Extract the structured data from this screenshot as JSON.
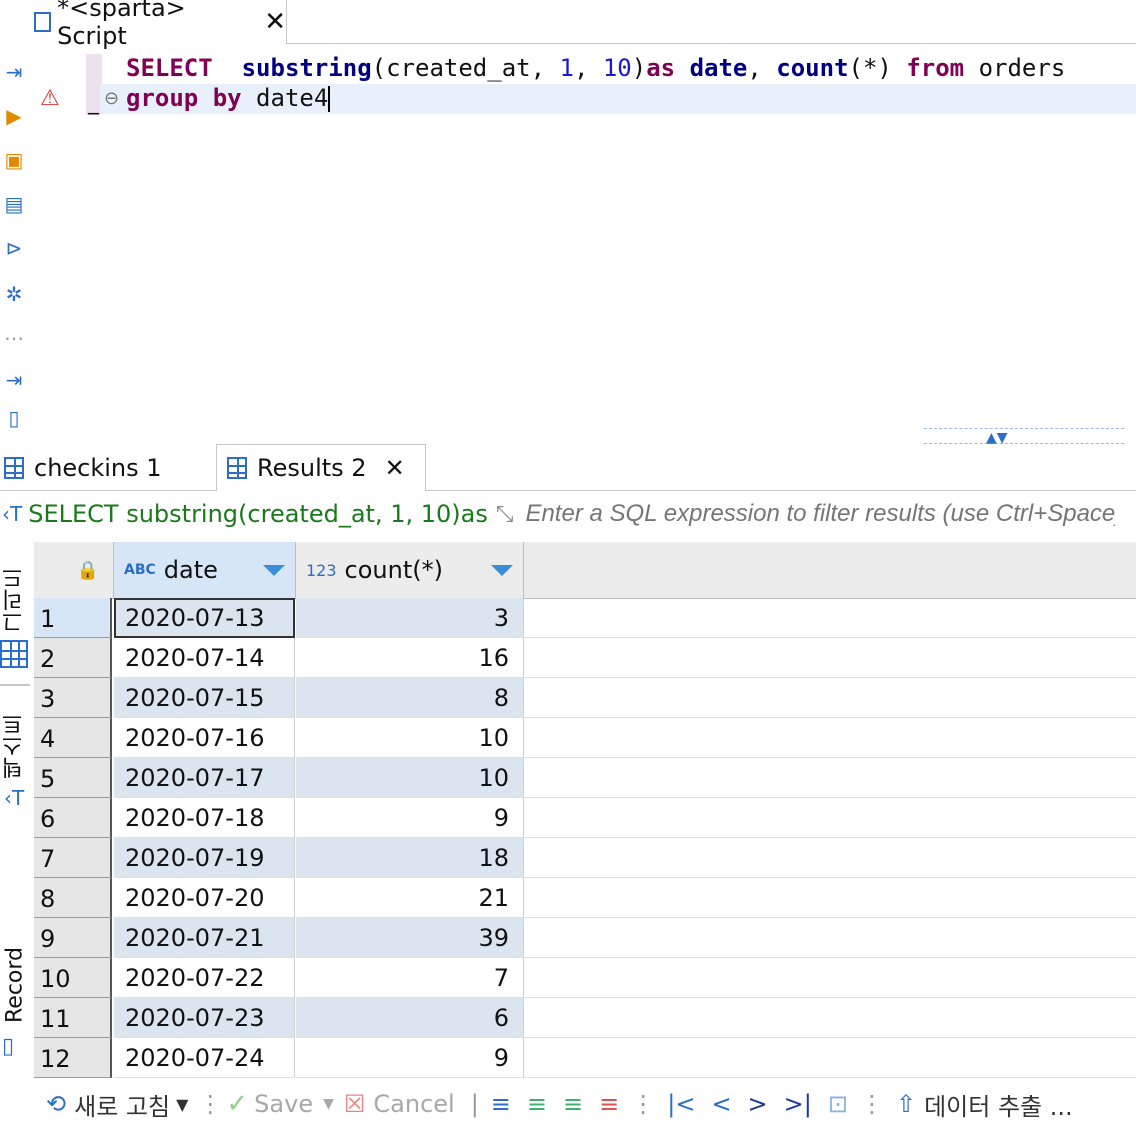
{
  "editor_tab": {
    "title": "*<sparta> Script",
    "close": "✕"
  },
  "editor": {
    "line1": {
      "kw_select": "SELECT",
      "fn_substring": "substring",
      "args": "(created_at, ",
      "n1": "1",
      "comma": ", ",
      "n2": "10",
      "paren": ")",
      "kw_as": "as",
      "date": " date",
      "comma2": ", ",
      "fn_count": "count",
      "count_args": "(*) ",
      "kw_from": "from",
      "table": " orders"
    },
    "line2": {
      "kw_group": "group",
      "kw_by": " by",
      "rest": " date4"
    }
  },
  "results_tabs": [
    {
      "label": "checkins 1"
    },
    {
      "label": "Results 2",
      "close": "✕"
    }
  ],
  "filter_bar": {
    "query_echo": "SELECT substring(created_at, 1, 10)as",
    "placeholder": "Enter a SQL expression to filter results (use Ctrl+Space)"
  },
  "side_tabs": {
    "grid": "그리드",
    "text": "텍스트",
    "record": "Record"
  },
  "grid": {
    "columns": [
      {
        "type_badge": "ABC",
        "name": "date"
      },
      {
        "type_badge": "123",
        "name": "count(*)"
      }
    ],
    "rows": [
      {
        "n": "1",
        "date": "2020-07-13",
        "count": "3"
      },
      {
        "n": "2",
        "date": "2020-07-14",
        "count": "16"
      },
      {
        "n": "3",
        "date": "2020-07-15",
        "count": "8"
      },
      {
        "n": "4",
        "date": "2020-07-16",
        "count": "10"
      },
      {
        "n": "5",
        "date": "2020-07-17",
        "count": "10"
      },
      {
        "n": "6",
        "date": "2020-07-18",
        "count": "9"
      },
      {
        "n": "7",
        "date": "2020-07-19",
        "count": "18"
      },
      {
        "n": "8",
        "date": "2020-07-20",
        "count": "21"
      },
      {
        "n": "9",
        "date": "2020-07-21",
        "count": "39"
      },
      {
        "n": "10",
        "date": "2020-07-22",
        "count": "7"
      },
      {
        "n": "11",
        "date": "2020-07-23",
        "count": "6"
      },
      {
        "n": "12",
        "date": "2020-07-24",
        "count": "9"
      }
    ]
  },
  "bottom_bar": {
    "refresh": "새로 고침",
    "save": "Save",
    "cancel": "Cancel",
    "export": "데이터 추출 ..."
  },
  "colors": {
    "keyword": "#7f0055",
    "function": "#000080",
    "number": "#1a1acc",
    "accent": "#2b6ec9",
    "row_alt": "#dbe5f0"
  }
}
